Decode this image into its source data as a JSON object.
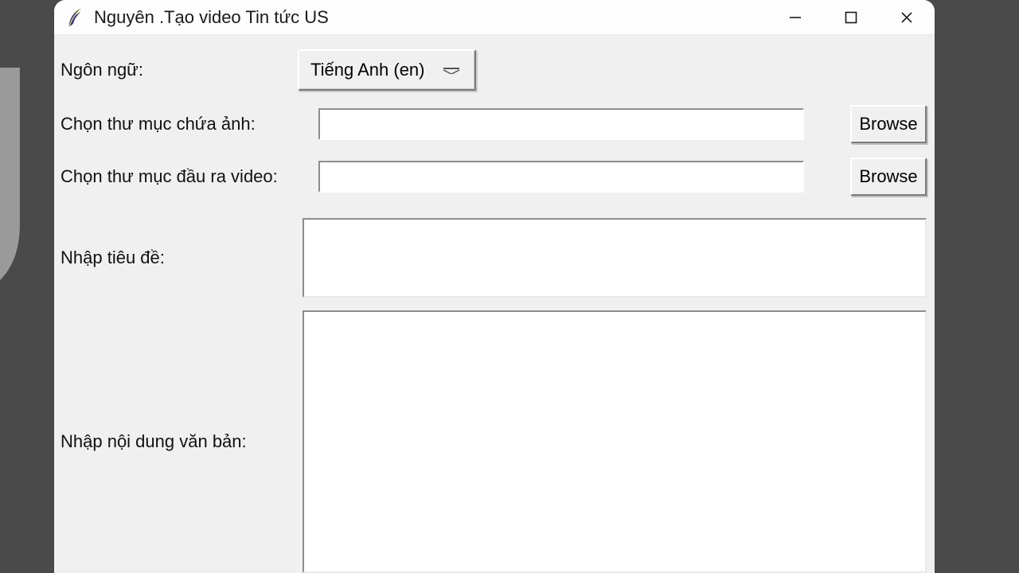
{
  "window": {
    "title": "Nguyên .Tạo video Tin tức US"
  },
  "form": {
    "language": {
      "label": "Ngôn ngữ:",
      "selected": "Tiếng Anh (en)"
    },
    "image_dir": {
      "label": "Chọn thư mục chứa ảnh:",
      "value": "",
      "browse": "Browse"
    },
    "output_dir": {
      "label": "Chọn thư mục đầu ra video:",
      "value": "",
      "browse": "Browse"
    },
    "title_field": {
      "label": "Nhập tiêu đề:",
      "value": ""
    },
    "body_field": {
      "label": "Nhập nội dung văn bản:",
      "value": ""
    }
  }
}
